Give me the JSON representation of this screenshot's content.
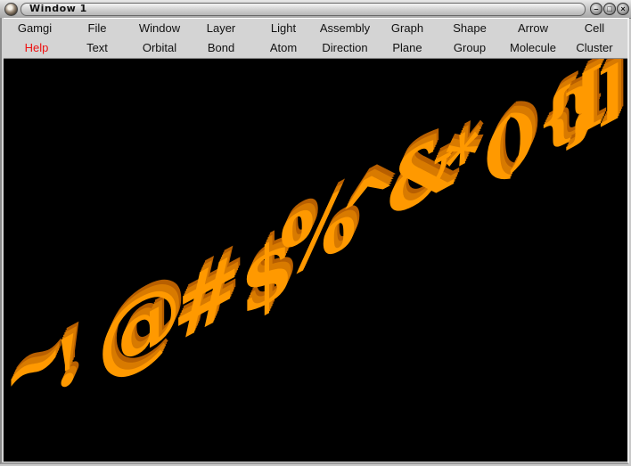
{
  "window": {
    "title": "Window 1",
    "controls": {
      "minimize": "–",
      "maximize": "□",
      "close": "×"
    }
  },
  "menubar": {
    "row1": [
      "Gamgi",
      "File",
      "Window",
      "Layer",
      "Light",
      "Assembly",
      "Graph",
      "Shape",
      "Arrow",
      "Cell"
    ],
    "row2": [
      "Help",
      "Text",
      "Orbital",
      "Bond",
      "Atom",
      "Direction",
      "Plane",
      "Group",
      "Molecule",
      "Cluster"
    ],
    "highlight_item": "Help",
    "highlight_color": "#ee1111"
  },
  "scene": {
    "background": "#000000",
    "text_color": "#ff9900",
    "text_shade": "#b85f00",
    "glyphs": [
      "~",
      "!",
      "@",
      "#",
      "$",
      "%",
      "^",
      "&",
      "*",
      "(",
      ")",
      "{",
      "}",
      "[",
      "]"
    ]
  }
}
